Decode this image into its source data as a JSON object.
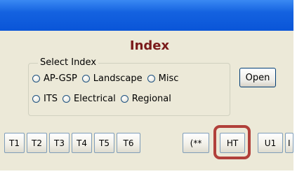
{
  "window": {
    "title": "Index"
  },
  "select_index": {
    "legend": "Select Index",
    "options_row1": [
      "AP-GSP",
      "Landscape",
      "Misc"
    ],
    "options_row2": [
      "ITS",
      "Electrical",
      "Regional"
    ],
    "open_label": "Open"
  },
  "toolbar": {
    "buttons": [
      "T1",
      "T2",
      "T3",
      "T4",
      "T5",
      "T6",
      "(**",
      "HT",
      "U1",
      "I"
    ],
    "highlighted": "HT"
  },
  "colors": {
    "titlebar": "#1462e0",
    "window_bg": "#ece9d8",
    "title_text": "#7a1a1a",
    "highlight_border": "#b1403a"
  }
}
